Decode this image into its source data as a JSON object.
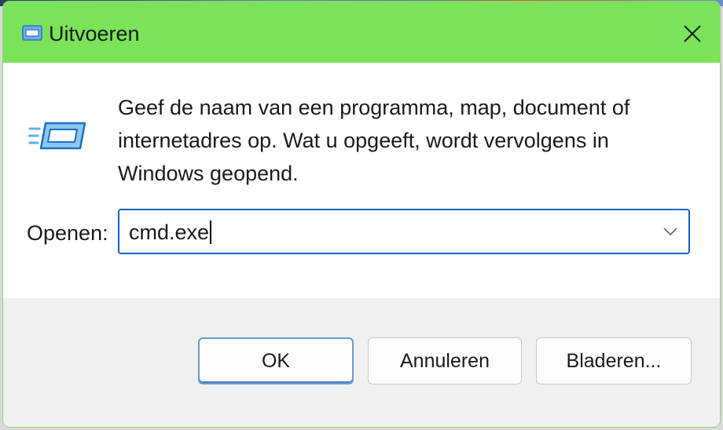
{
  "window": {
    "title": "Uitvoeren",
    "titlebar_color": "#7be35a"
  },
  "icons": {
    "title_icon": "run-dialog-icon",
    "main_icon": "run-dialog-icon",
    "close_icon": "close-icon",
    "dropdown_icon": "chevron-down-icon"
  },
  "dialog": {
    "description": "Geef de naam van een programma, map, document of internetadres op. Wat u opgeeft, wordt vervolgens in Windows geopend.",
    "open_label": "Openen:",
    "open_value": "cmd.exe"
  },
  "buttons": {
    "ok": "OK",
    "cancel": "Annuleren",
    "browse": "Bladeren..."
  },
  "colors": {
    "accent": "#0a63c2",
    "ok_border": "#6d99cf"
  }
}
